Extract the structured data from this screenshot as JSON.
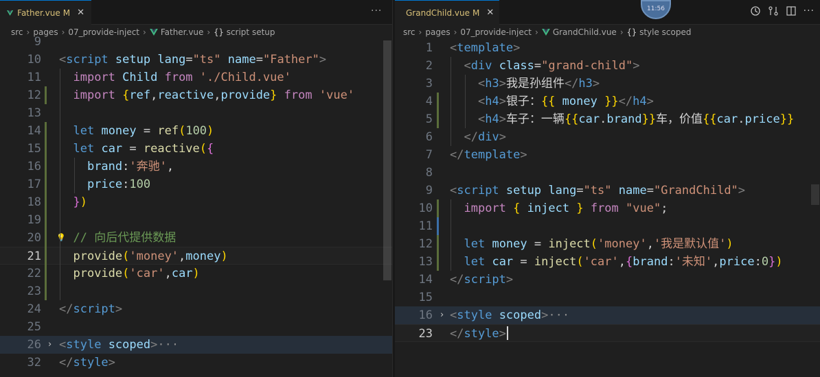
{
  "left": {
    "tab": {
      "title": "Father.vue",
      "modified": "M",
      "close": "✕"
    },
    "more": "···",
    "breadcrumb": [
      "src",
      "pages",
      "07_provide-inject",
      "Father.vue",
      "script setup"
    ],
    "lines": [
      {
        "n": "9",
        "tokens": []
      },
      {
        "n": "10",
        "tokens": [
          [
            "t-br",
            "<"
          ],
          [
            "t-tag",
            "script"
          ],
          [
            "t-txt",
            " "
          ],
          [
            "t-attr",
            "setup"
          ],
          [
            "t-txt",
            " "
          ],
          [
            "t-attr",
            "lang"
          ],
          [
            "t-txt",
            "="
          ],
          [
            "t-str",
            "\"ts\""
          ],
          [
            "t-txt",
            " "
          ],
          [
            "t-attr",
            "name"
          ],
          [
            "t-txt",
            "="
          ],
          [
            "t-str",
            "\"Father\""
          ],
          [
            "t-br",
            ">"
          ]
        ]
      },
      {
        "n": "11",
        "tokens": [
          [
            "t-txt",
            "  "
          ],
          [
            "t-imp",
            "import"
          ],
          [
            "t-txt",
            " "
          ],
          [
            "t-var",
            "Child"
          ],
          [
            "t-txt",
            " "
          ],
          [
            "t-imp",
            "from"
          ],
          [
            "t-txt",
            " "
          ],
          [
            "t-str",
            "'./Child.vue'"
          ]
        ]
      },
      {
        "n": "12",
        "tokens": [
          [
            "t-txt",
            "  "
          ],
          [
            "t-imp",
            "import"
          ],
          [
            "t-txt",
            " "
          ],
          [
            "t-y",
            "{"
          ],
          [
            "t-var",
            "ref"
          ],
          [
            "t-txt",
            ","
          ],
          [
            "t-var",
            "reactive"
          ],
          [
            "t-txt",
            ","
          ],
          [
            "t-var",
            "provide"
          ],
          [
            "t-y",
            "}"
          ],
          [
            "t-txt",
            " "
          ],
          [
            "t-imp",
            "from"
          ],
          [
            "t-txt",
            " "
          ],
          [
            "t-str",
            "'vue'"
          ]
        ]
      },
      {
        "n": "13",
        "tokens": []
      },
      {
        "n": "14",
        "tokens": [
          [
            "t-txt",
            "  "
          ],
          [
            "t-kw",
            "let"
          ],
          [
            "t-txt",
            " "
          ],
          [
            "t-var",
            "money"
          ],
          [
            "t-txt",
            " = "
          ],
          [
            "t-fn",
            "ref"
          ],
          [
            "t-y",
            "("
          ],
          [
            "t-num",
            "100"
          ],
          [
            "t-y",
            ")"
          ]
        ]
      },
      {
        "n": "15",
        "tokens": [
          [
            "t-txt",
            "  "
          ],
          [
            "t-kw",
            "let"
          ],
          [
            "t-txt",
            " "
          ],
          [
            "t-var",
            "car"
          ],
          [
            "t-txt",
            " = "
          ],
          [
            "t-fn",
            "reactive"
          ],
          [
            "t-y",
            "("
          ],
          [
            "t-m",
            "{"
          ]
        ]
      },
      {
        "n": "16",
        "tokens": [
          [
            "t-txt",
            "    "
          ],
          [
            "t-var",
            "brand"
          ],
          [
            "t-txt",
            ":"
          ],
          [
            "t-str",
            "'奔驰'"
          ],
          [
            "t-txt",
            ","
          ]
        ]
      },
      {
        "n": "17",
        "tokens": [
          [
            "t-txt",
            "    "
          ],
          [
            "t-var",
            "price"
          ],
          [
            "t-txt",
            ":"
          ],
          [
            "t-num",
            "100"
          ]
        ]
      },
      {
        "n": "18",
        "tokens": [
          [
            "t-txt",
            "  "
          ],
          [
            "t-m",
            "}"
          ],
          [
            "t-y",
            ")"
          ]
        ]
      },
      {
        "n": "19",
        "tokens": []
      },
      {
        "n": "20",
        "tokens": [
          [
            "t-txt",
            "  "
          ],
          [
            "t-cmt",
            "// 向后代提供数据"
          ]
        ]
      },
      {
        "n": "21",
        "tokens": [
          [
            "t-txt",
            "  "
          ],
          [
            "t-fn",
            "provide"
          ],
          [
            "t-y",
            "("
          ],
          [
            "t-str",
            "'money'"
          ],
          [
            "t-txt",
            ","
          ],
          [
            "t-var",
            "money"
          ],
          [
            "t-y",
            ")"
          ]
        ]
      },
      {
        "n": "22",
        "tokens": [
          [
            "t-txt",
            "  "
          ],
          [
            "t-fn",
            "provide"
          ],
          [
            "t-y",
            "("
          ],
          [
            "t-str",
            "'car'"
          ],
          [
            "t-txt",
            ","
          ],
          [
            "t-var",
            "car"
          ],
          [
            "t-y",
            ")"
          ]
        ]
      },
      {
        "n": "23",
        "tokens": []
      },
      {
        "n": "24",
        "tokens": [
          [
            "t-br",
            "</"
          ],
          [
            "t-tag",
            "script"
          ],
          [
            "t-br",
            ">"
          ]
        ]
      },
      {
        "n": "25",
        "tokens": []
      },
      {
        "n": "26",
        "tokens": [
          [
            "t-br",
            "<"
          ],
          [
            "t-tag",
            "style"
          ],
          [
            "t-txt",
            " "
          ],
          [
            "t-attr",
            "scoped"
          ],
          [
            "t-br",
            ">"
          ],
          [
            "ellip",
            "···"
          ]
        ]
      },
      {
        "n": "32",
        "tokens": [
          [
            "t-br",
            "</"
          ],
          [
            "t-tag",
            "style"
          ],
          [
            "t-br",
            ">"
          ]
        ]
      }
    ],
    "active_line": "21"
  },
  "right": {
    "tab": {
      "title": "GrandChild.vue",
      "modified": "M",
      "close": "✕"
    },
    "breadcrumb": [
      "src",
      "pages",
      "07_provide-inject",
      "GrandChild.vue",
      "style scoped"
    ],
    "lines": [
      {
        "n": "1",
        "tokens": [
          [
            "t-br",
            "<"
          ],
          [
            "t-tag",
            "template"
          ],
          [
            "t-br",
            ">"
          ]
        ]
      },
      {
        "n": "2",
        "tokens": [
          [
            "t-txt",
            "  "
          ],
          [
            "t-br",
            "<"
          ],
          [
            "t-tag",
            "div"
          ],
          [
            "t-txt",
            " "
          ],
          [
            "t-attr",
            "class"
          ],
          [
            "t-txt",
            "="
          ],
          [
            "t-str",
            "\"grand-child\""
          ],
          [
            "t-br",
            ">"
          ]
        ]
      },
      {
        "n": "3",
        "tokens": [
          [
            "t-txt",
            "    "
          ],
          [
            "t-br",
            "<"
          ],
          [
            "t-tag",
            "h3"
          ],
          [
            "t-br",
            ">"
          ],
          [
            "t-txt",
            "我是孙组件"
          ],
          [
            "t-br",
            "</"
          ],
          [
            "t-tag",
            "h3"
          ],
          [
            "t-br",
            ">"
          ]
        ]
      },
      {
        "n": "4",
        "tokens": [
          [
            "t-txt",
            "    "
          ],
          [
            "t-br",
            "<"
          ],
          [
            "t-tag",
            "h4"
          ],
          [
            "t-br",
            ">"
          ],
          [
            "t-txt",
            "银子："
          ],
          [
            "t-y",
            "{{"
          ],
          [
            "t-txt",
            " "
          ],
          [
            "t-var",
            "money"
          ],
          [
            "t-txt",
            " "
          ],
          [
            "t-y",
            "}}"
          ],
          [
            "t-br",
            "</"
          ],
          [
            "t-tag",
            "h4"
          ],
          [
            "t-br",
            ">"
          ]
        ]
      },
      {
        "n": "5",
        "tokens": [
          [
            "t-txt",
            "    "
          ],
          [
            "t-br",
            "<"
          ],
          [
            "t-tag",
            "h4"
          ],
          [
            "t-br",
            ">"
          ],
          [
            "t-txt",
            "车子：一辆"
          ],
          [
            "t-y",
            "{{"
          ],
          [
            "t-var",
            "car"
          ],
          [
            "t-txt",
            "."
          ],
          [
            "t-var",
            "brand"
          ],
          [
            "t-y",
            "}}"
          ],
          [
            "t-txt",
            "车，价值"
          ],
          [
            "t-y",
            "{{"
          ],
          [
            "t-var",
            "car"
          ],
          [
            "t-txt",
            "."
          ],
          [
            "t-var",
            "price"
          ],
          [
            "t-y",
            "}}"
          ]
        ]
      },
      {
        "n": "6",
        "tokens": [
          [
            "t-txt",
            "  "
          ],
          [
            "t-br",
            "</"
          ],
          [
            "t-tag",
            "div"
          ],
          [
            "t-br",
            ">"
          ]
        ]
      },
      {
        "n": "7",
        "tokens": [
          [
            "t-br",
            "</"
          ],
          [
            "t-tag",
            "template"
          ],
          [
            "t-br",
            ">"
          ]
        ]
      },
      {
        "n": "8",
        "tokens": []
      },
      {
        "n": "9",
        "tokens": [
          [
            "t-br",
            "<"
          ],
          [
            "t-tag",
            "script"
          ],
          [
            "t-txt",
            " "
          ],
          [
            "t-attr",
            "setup"
          ],
          [
            "t-txt",
            " "
          ],
          [
            "t-attr",
            "lang"
          ],
          [
            "t-txt",
            "="
          ],
          [
            "t-str",
            "\"ts\""
          ],
          [
            "t-txt",
            " "
          ],
          [
            "t-attr",
            "name"
          ],
          [
            "t-txt",
            "="
          ],
          [
            "t-str",
            "\"GrandChild\""
          ],
          [
            "t-br",
            ">"
          ]
        ]
      },
      {
        "n": "10",
        "tokens": [
          [
            "t-txt",
            "  "
          ],
          [
            "t-imp",
            "import"
          ],
          [
            "t-txt",
            " "
          ],
          [
            "t-y",
            "{"
          ],
          [
            "t-txt",
            " "
          ],
          [
            "t-var",
            "inject"
          ],
          [
            "t-txt",
            " "
          ],
          [
            "t-y",
            "}"
          ],
          [
            "t-txt",
            " "
          ],
          [
            "t-imp",
            "from"
          ],
          [
            "t-txt",
            " "
          ],
          [
            "t-str",
            "\"vue\""
          ],
          [
            "t-txt",
            ";"
          ]
        ]
      },
      {
        "n": "11",
        "tokens": []
      },
      {
        "n": "12",
        "tokens": [
          [
            "t-txt",
            "  "
          ],
          [
            "t-kw",
            "let"
          ],
          [
            "t-txt",
            " "
          ],
          [
            "t-var",
            "money"
          ],
          [
            "t-txt",
            " = "
          ],
          [
            "t-fn",
            "inject"
          ],
          [
            "t-y",
            "("
          ],
          [
            "t-str",
            "'money'"
          ],
          [
            "t-txt",
            ","
          ],
          [
            "t-str",
            "'我是默认值'"
          ],
          [
            "t-y",
            ")"
          ]
        ]
      },
      {
        "n": "13",
        "tokens": [
          [
            "t-txt",
            "  "
          ],
          [
            "t-kw",
            "let"
          ],
          [
            "t-txt",
            " "
          ],
          [
            "t-var",
            "car"
          ],
          [
            "t-txt",
            " = "
          ],
          [
            "t-fn",
            "inject"
          ],
          [
            "t-y",
            "("
          ],
          [
            "t-str",
            "'car'"
          ],
          [
            "t-txt",
            ","
          ],
          [
            "t-m",
            "{"
          ],
          [
            "t-var",
            "brand"
          ],
          [
            "t-txt",
            ":"
          ],
          [
            "t-str",
            "'未知'"
          ],
          [
            "t-txt",
            ","
          ],
          [
            "t-var",
            "price"
          ],
          [
            "t-txt",
            ":"
          ],
          [
            "t-num",
            "0"
          ],
          [
            "t-m",
            "}"
          ],
          [
            "t-y",
            ")"
          ]
        ]
      },
      {
        "n": "14",
        "tokens": [
          [
            "t-br",
            "</"
          ],
          [
            "t-tag",
            "script"
          ],
          [
            "t-br",
            ">"
          ]
        ]
      },
      {
        "n": "15",
        "tokens": []
      },
      {
        "n": "16",
        "tokens": [
          [
            "t-br",
            "<"
          ],
          [
            "t-tag",
            "style"
          ],
          [
            "t-txt",
            " "
          ],
          [
            "t-attr",
            "scoped"
          ],
          [
            "t-br",
            ">"
          ],
          [
            "ellip",
            "···"
          ]
        ]
      },
      {
        "n": "23",
        "tokens": [
          [
            "t-br",
            "</"
          ],
          [
            "t-tag",
            "style"
          ],
          [
            "t-br",
            ">"
          ]
        ]
      }
    ],
    "active_line": "23"
  },
  "avatar_text": "11:56"
}
